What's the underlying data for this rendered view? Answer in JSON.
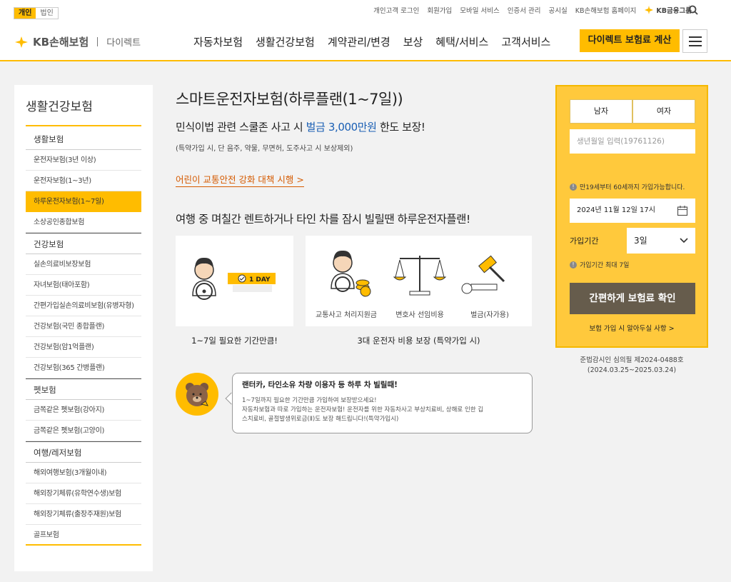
{
  "util": {
    "segments": [
      "개인",
      "법인"
    ],
    "links": [
      "개인고객 로그인",
      "회원가입",
      "모바일 서비스",
      "인증서 관리",
      "공시실",
      "KB손해보험 홈페이지"
    ],
    "group": "KB금융그룹"
  },
  "gnb": {
    "logo_brand": "KB손해보험",
    "logo_sub": "다이렉트",
    "nav": [
      "자동차보험",
      "생활건강보험",
      "계약관리/변경",
      "보상",
      "혜택/서비스",
      "고객서비스"
    ],
    "cta": "다이렉트 보험료 계산"
  },
  "sidebar": {
    "title": "생활건강보험",
    "groups": [
      {
        "label": "생활보험",
        "items": [
          "운전자보험(3년 이상)",
          "운전자보험(1~3년)",
          "하루운전자보험(1~7일)",
          "소상공인종합보험"
        ]
      },
      {
        "label": "건강보험",
        "items": [
          "실손의료비보장보험",
          "자녀보험(태아포함)",
          "간편가입실손의료비보험(유병자형)",
          "건강보험(국민 종합플랜)",
          "건강보험(암1억플랜)",
          "건강보험(365 간병플랜)"
        ]
      },
      {
        "label": "펫보험",
        "items": [
          "금쪽같은 펫보험(강아지)",
          "금쪽같은 펫보험(고양이)"
        ]
      },
      {
        "label": "여행/레저보험",
        "items": [
          "해외여행보험(3개월이내)",
          "해외장기체류(유학연수생)보험",
          "해외장기체류(출장주재원)보험",
          "골프보험"
        ]
      }
    ],
    "active": "하루운전자보험(1~7일)"
  },
  "main": {
    "title": "스마트운전자보험(하루플랜(1~7일))",
    "headline_pre": "민식이법 관련 스쿨존 사고 시 ",
    "headline_hl": "벌금 3,000만원",
    "headline_post": " 한도 보장!",
    "subnote": "(특약가입 시, 단 음주, 약물, 무면허, 도주사고 시 보상제외)",
    "link": "어린이 교통안전 강화 대책 시행 >",
    "section_head": "여행 중 며칠간 렌트하거나 타인 차를 잠시 빌릴땐 하루운전자플랜!",
    "badge": "1 DAY",
    "card1_caption": "1~7일 필요한 기간만큼!",
    "card2_icons": [
      "교통사고 처리지원금",
      "변호사 선임비용",
      "벌금(자가용)"
    ],
    "card2_caption": "3대 운전자 비용 보장 (특약가입 시)",
    "bubble_title": "랜터카, 타인소유 차량 이용자 등 하루 차 빌릴때!",
    "bubble_line1": "1~7일까지 필요한 기간만큼 가입하여 보장받으세요!",
    "bubble_line2": "자동차보험과 따로 가입하는 운전자보험! 운전자를 위한 자동차사고 부상치료비, 상해로 인한 깁",
    "bubble_line3": "스치료비, 골절발생위로금(Ⅱ)도 보장 해드립니다!(특약가입시)"
  },
  "calc": {
    "male": "남자",
    "female": "여자",
    "birth_placeholder": "생년월일 입력(19761126)",
    "age_note": "만19세부터 60세까지 가입가능합니다.",
    "date": "2024년 11월 12일 17시",
    "period_label": "가입기간",
    "period_value": "3일",
    "period_note": "가입기간 최대 7일",
    "confirm": "간편하게 보험료 확인",
    "link": "보험 가입 시 알아두실 사항 >",
    "approval_1": "준법감시인 심의필 제2024-0488호",
    "approval_2": "(2024.03.25~2025.03.24)"
  },
  "colors": {
    "accent": "#ffbc00",
    "dark_button": "#665c4c",
    "link_orange": "#d55a00",
    "highlight_blue": "#1a5fb4"
  }
}
